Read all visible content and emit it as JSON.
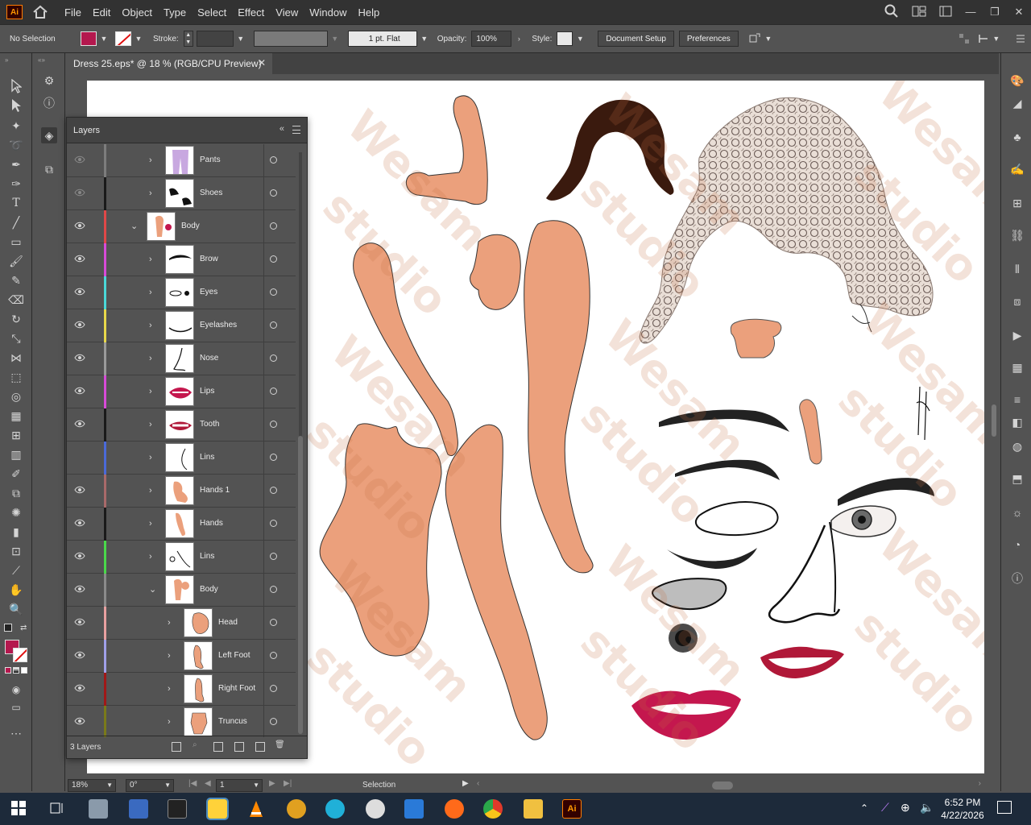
{
  "app": {
    "logo_text": "Ai"
  },
  "menubar": {
    "items": [
      "File",
      "Edit",
      "Object",
      "Type",
      "Select",
      "Effect",
      "View",
      "Window",
      "Help"
    ]
  },
  "control_bar": {
    "selection_status": "No Selection",
    "fill_color": "#b4184e",
    "stroke_label": "Stroke:",
    "stroke_profile": "1 pt. Flat",
    "opacity_label": "Opacity:",
    "opacity_value": "100%",
    "style_label": "Style:",
    "document_setup": "Document Setup",
    "preferences": "Preferences"
  },
  "document": {
    "tab_title": "Dress 25.eps* @ 18 % (RGB/CPU Preview)"
  },
  "layers_panel": {
    "title": "Layers",
    "layer_count": "3 Layers",
    "rows": [
      {
        "name": "Pants",
        "color": "#7d7d7d",
        "visible": true,
        "dimmed": true,
        "indent": 1,
        "expanded": false,
        "thumb": "pants"
      },
      {
        "name": "Shoes",
        "color": "#1a1a1a",
        "visible": true,
        "dimmed": true,
        "indent": 1,
        "expanded": false,
        "thumb": "shoes"
      },
      {
        "name": "Body",
        "color": "#e04848",
        "visible": true,
        "dimmed": false,
        "indent": 0,
        "expanded": true,
        "thumb": "body-full"
      },
      {
        "name": "Brow",
        "color": "#d84ad8",
        "visible": true,
        "dimmed": false,
        "indent": 1,
        "expanded": false,
        "thumb": "brow"
      },
      {
        "name": "Eyes",
        "color": "#4ad8d8",
        "visible": true,
        "dimmed": false,
        "indent": 1,
        "expanded": false,
        "thumb": "eyes"
      },
      {
        "name": "Eyelashes",
        "color": "#e8d84a",
        "visible": true,
        "dimmed": false,
        "indent": 1,
        "expanded": false,
        "thumb": "eyelashes"
      },
      {
        "name": "Nose",
        "color": "#9a9a9a",
        "visible": true,
        "dimmed": false,
        "indent": 1,
        "expanded": false,
        "thumb": "nose"
      },
      {
        "name": "Lips",
        "color": "#d84ad8",
        "visible": true,
        "dimmed": false,
        "indent": 1,
        "expanded": false,
        "thumb": "lips"
      },
      {
        "name": "Tooth",
        "color": "#1a1a1a",
        "visible": true,
        "dimmed": false,
        "indent": 1,
        "expanded": false,
        "thumb": "tooth"
      },
      {
        "name": "Lins",
        "color": "#4a6ad8",
        "visible": false,
        "dimmed": false,
        "indent": 1,
        "expanded": false,
        "thumb": "lins"
      },
      {
        "name": "Hands 1",
        "color": "#a86a6a",
        "visible": true,
        "dimmed": false,
        "indent": 1,
        "expanded": false,
        "thumb": "hands1"
      },
      {
        "name": "Hands",
        "color": "#1a1a1a",
        "visible": true,
        "dimmed": false,
        "indent": 1,
        "expanded": false,
        "thumb": "hands"
      },
      {
        "name": "Lins",
        "color": "#4ad84a",
        "visible": true,
        "dimmed": false,
        "indent": 1,
        "expanded": false,
        "thumb": "lins2"
      },
      {
        "name": "Body",
        "color": "#8a8a8a",
        "visible": true,
        "dimmed": false,
        "indent": 1,
        "expanded": true,
        "thumb": "body"
      },
      {
        "name": "Head",
        "color": "#e8a0a0",
        "visible": true,
        "dimmed": false,
        "indent": 2,
        "expanded": false,
        "thumb": "head"
      },
      {
        "name": "Left Foot",
        "color": "#a0a0e8",
        "visible": true,
        "dimmed": false,
        "indent": 2,
        "expanded": false,
        "thumb": "leftfoot"
      },
      {
        "name": "Right Foot",
        "color": "#a01818",
        "visible": true,
        "dimmed": false,
        "indent": 2,
        "expanded": false,
        "thumb": "rightfoot"
      },
      {
        "name": "Truncus",
        "color": "#7a7a1a",
        "visible": true,
        "dimmed": false,
        "indent": 2,
        "expanded": false,
        "thumb": "truncus"
      }
    ]
  },
  "status_bar": {
    "zoom": "18%",
    "rotation": "0°",
    "artboard_number": "1",
    "current_tool": "Selection"
  },
  "taskbar": {
    "time": "6:52 PM",
    "date": "4/22/2026"
  },
  "canvas": {
    "watermark_text": "Wesam studio",
    "skin_color": "#eba07c",
    "hair_color": "#3a1a0e",
    "lip_color": "#c4174e"
  }
}
